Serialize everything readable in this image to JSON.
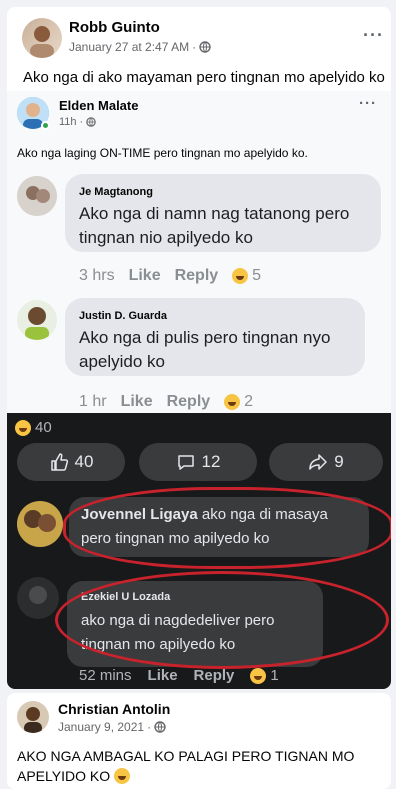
{
  "post": {
    "author": "Robb Guinto",
    "timestamp": "January 27 at 2:47 AM",
    "text": "Ako nga di ako mayaman pero tingnan mo apelyido ko"
  },
  "shared": {
    "author": "Elden Malate",
    "timestamp": "11h",
    "text": "Ako nga laging ON-TIME pero tingnan mo apelyido ko.",
    "comments": [
      {
        "name": "Je Magtanong",
        "text_line1": "Ako nga di namn nag tatanong pero",
        "text_line2": "tingnan nio apilyedo ko",
        "time": "3 hrs",
        "like": "Like",
        "reply": "Reply",
        "reactions": "5"
      },
      {
        "name": "Justin D. Guarda",
        "text_line1": "Ako nga di  pulis pero tingnan nyo",
        "text_line2": "apelyido ko",
        "time": "1 hr",
        "like": "Like",
        "reply": "Reply",
        "reactions": "2"
      }
    ],
    "dark": {
      "reaction_count": "40",
      "like_count": "40",
      "comment_count": "12",
      "share_count": "9",
      "comments": [
        {
          "name": "Jovennel Ligaya",
          "text_inline": " ako nga di masaya",
          "text_line2": "pero tingnan mo apilyedo ko"
        },
        {
          "name": "Ezekiel U Lozada",
          "text_line1": "ako nga di nagdedeliver pero",
          "text_line2": "tingnan mo apilyedo ko",
          "time": "52 mins",
          "like": "Like",
          "reply": "Reply",
          "reactions": "1"
        }
      ]
    }
  },
  "post2": {
    "author": "Christian Antolin",
    "timestamp": "January 9, 2021",
    "text_line1": "AKO NGA AMBAGAL KO PALAGI PERO TIGNAN MO",
    "text_line2": "APELYIDO KO"
  },
  "colors": {
    "ring": "#c8232c",
    "bg": "#f0f2f5",
    "dark_bg": "#18191a"
  },
  "icons": [
    "globe-icon",
    "more-icon",
    "like-icon",
    "comment-icon",
    "share-icon",
    "haha-emoji-icon"
  ]
}
